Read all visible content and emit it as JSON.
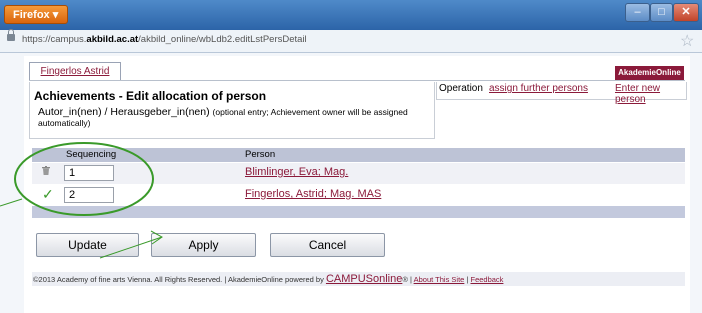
{
  "browser": {
    "menu_label": "Firefox ▾",
    "url_host": "https://campus.",
    "url_domain": "akbild.ac.at",
    "url_path": "/akbild_online/wbLdb2.editLstPersDetail"
  },
  "tab": {
    "label": "Fingerlos Astrid"
  },
  "logo": {
    "text": "AkademieOnline"
  },
  "heading": {
    "title": "Achievements - Edit allocation of person",
    "subtitle_main": "Autor_in(nen) / Herausgeber_in(nen)",
    "subtitle_note": "(optional entry; Achievement owner will be assigned automatically)"
  },
  "operations": {
    "label": "Operation",
    "assign_link": "assign further persons",
    "new_link": "Enter new person"
  },
  "table": {
    "col_sequencing": "Sequencing",
    "col_person": "Person",
    "rows": [
      {
        "sequence": "1",
        "person": "Blimlinger, Eva; Mag.",
        "icon": "trash-icon"
      },
      {
        "sequence": "2",
        "person": "Fingerlos, Astrid; Mag. MAS",
        "icon": "check-icon"
      }
    ]
  },
  "buttons": {
    "update": "Update",
    "apply": "Apply",
    "cancel": "Cancel"
  },
  "footer": {
    "copyright": "©2013 Academy of fine arts Vienna. All Rights Reserved. | AkademieOnline powered by",
    "brand": "CAMPUSonline",
    "reg": "®",
    "about": "About This Site",
    "sep": "|",
    "feedback": "Feedback"
  },
  "colors": {
    "accent": "#8b1a3a",
    "annotation": "#3a9a2a",
    "table_header": "#bdc3d6"
  }
}
